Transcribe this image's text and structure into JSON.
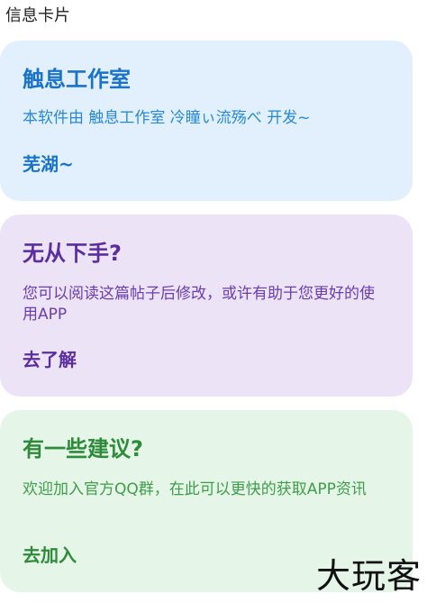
{
  "section_header": "信息卡片",
  "cards": [
    {
      "title": "触息工作室",
      "body": "本软件由 触息工作室 冷瞳ぃ流殇べ 开发~",
      "action": "芜湖~"
    },
    {
      "title": "无从下手?",
      "body": "您可以阅读这篇帖子后修改，或许有助于您更好的使用APP",
      "action": "去了解"
    },
    {
      "title": "有一些建议?",
      "body": "欢迎加入官方QQ群，在此可以更快的获取APP资讯",
      "action": "去加入"
    }
  ],
  "watermark": "大玩客",
  "colors": {
    "blue_card_bg": "#e1f0fc",
    "purple_card_bg": "#ece4f6",
    "green_card_bg": "#e5f5e7",
    "blue_accent": "#1a73c8",
    "purple_accent": "#5a2e9e",
    "green_accent": "#2e8b3a"
  }
}
